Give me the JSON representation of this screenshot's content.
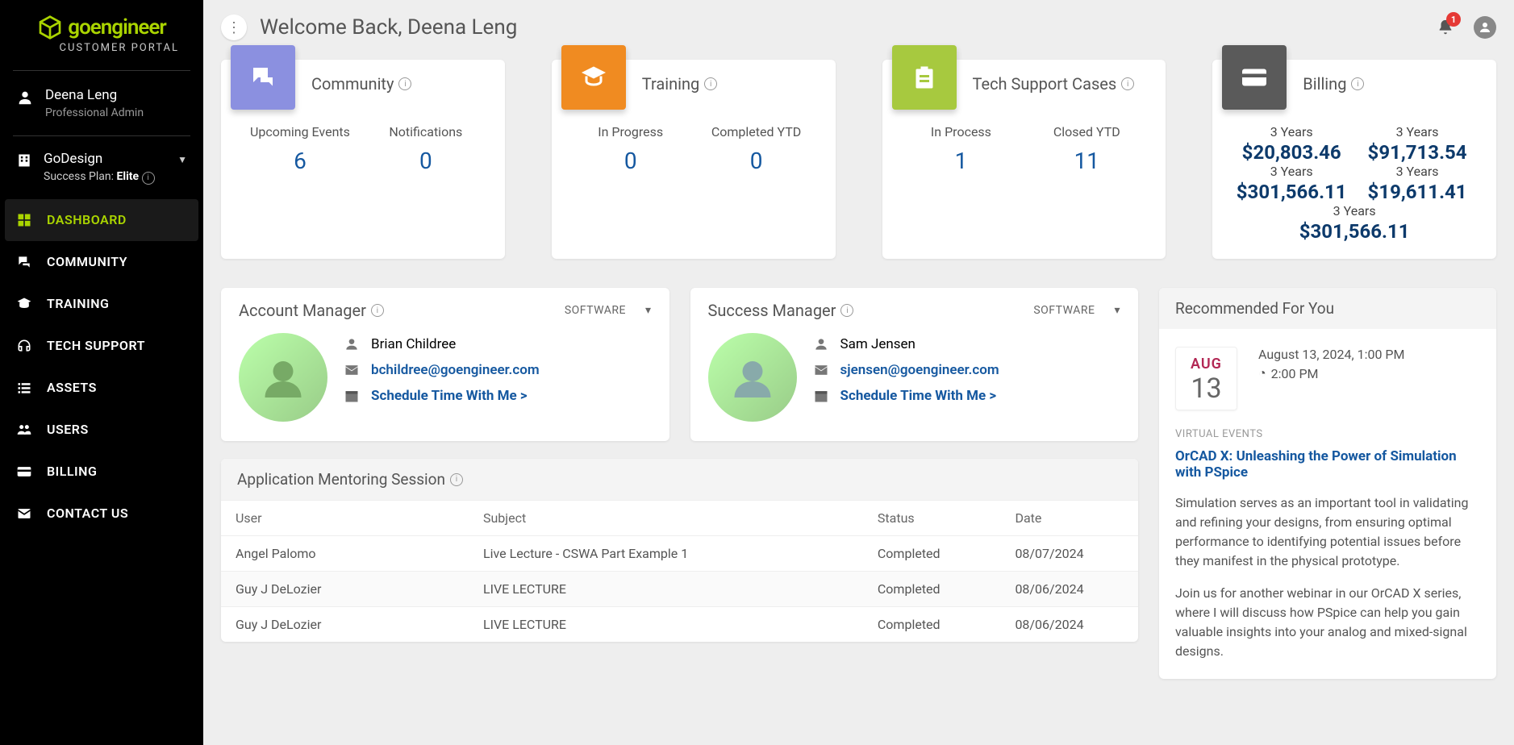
{
  "brand": {
    "name": "goengineer",
    "sub": "CUSTOMER PORTAL"
  },
  "user": {
    "name": "Deena Leng",
    "role": "Professional Admin"
  },
  "org": {
    "name": "GoDesign",
    "planLabel": "Success Plan:",
    "plan": "Elite"
  },
  "nav": {
    "dashboard": "DASHBOARD",
    "community": "COMMUNITY",
    "training": "TRAINING",
    "techsupport": "TECH SUPPORT",
    "assets": "ASSETS",
    "users": "USERS",
    "billing": "BILLING",
    "contact": "CONTACT US"
  },
  "welcome": "Welcome Back, Deena Leng",
  "notificationsBadge": "1",
  "cards": {
    "community": {
      "title": "Community",
      "l1": "Upcoming Events",
      "v1": "6",
      "l2": "Notifications",
      "v2": "0"
    },
    "training": {
      "title": "Training",
      "l1": "In Progress",
      "v1": "0",
      "l2": "Completed YTD",
      "v2": "0"
    },
    "support": {
      "title": "Tech Support  Cases",
      "l1": "In Process",
      "v1": "1",
      "l2": "Closed YTD",
      "v2": "11"
    },
    "billing": {
      "title": "Billing",
      "rows": [
        {
          "l1": "3 Years",
          "v1": "$20,803.46",
          "l2": "3 Years",
          "v2": "$91,713.54"
        },
        {
          "l1": "3 Years",
          "v1": "$301,566.11",
          "l2": "3 Years",
          "v2": "$19,611.41"
        },
        {
          "l1": "3 Years",
          "v1": "$301,566.11"
        }
      ]
    }
  },
  "managers": {
    "account": {
      "title": "Account Manager",
      "dropdown": "SOFTWARE",
      "name": "Brian Childree",
      "email": "bchildree@goengineer.com",
      "schedule": "Schedule Time With Me >"
    },
    "success": {
      "title": "Success Manager",
      "dropdown": "SOFTWARE",
      "name": "Sam Jensen",
      "email": "sjensen@goengineer.com",
      "schedule": "Schedule Time With Me >"
    }
  },
  "recommended": {
    "header": "Recommended For You",
    "month": "AUG",
    "day": "13",
    "line1": "August 13, 2024, 1:00 PM",
    "line2": "2:00 PM",
    "category": "VIRTUAL EVENTS",
    "title": "OrCAD X: Unleashing the Power of Simulation with PSpice",
    "p1": "Simulation serves as an important tool in validating and refining your designs, from ensuring optimal performance to identifying potential issues before they manifest in the physical prototype.",
    "p2": "Join us for another webinar in our OrCAD X series, where I will discuss how PSpice can help you gain valuable insights into your analog and mixed-signal designs."
  },
  "mentoring": {
    "title": "Application Mentoring Session",
    "cols": {
      "user": "User",
      "subject": "Subject",
      "status": "Status",
      "date": "Date"
    },
    "rows": [
      {
        "user": "Angel Palomo",
        "subject": "Live Lecture - CSWA Part Example 1",
        "status": "Completed",
        "date": "08/07/2024"
      },
      {
        "user": "Guy J DeLozier",
        "subject": "LIVE LECTURE",
        "status": "Completed",
        "date": "08/06/2024"
      },
      {
        "user": "Guy J DeLozier",
        "subject": "LIVE LECTURE",
        "status": "Completed",
        "date": "08/06/2024"
      }
    ]
  }
}
